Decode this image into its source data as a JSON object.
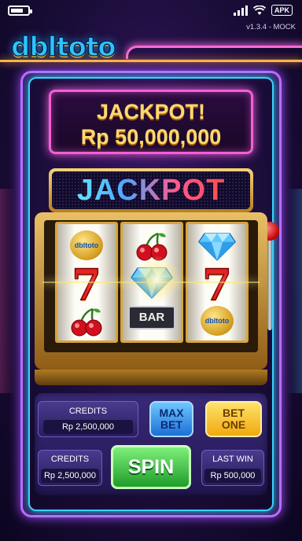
{
  "status_bar": {
    "battery_level": 0.75,
    "apk_badge": "APK",
    "icons": [
      "battery-icon",
      "signal-icon",
      "wifi-icon"
    ]
  },
  "app": {
    "version": "v1.3.4 - MOCK",
    "logo_text": "dbltoto"
  },
  "jackpot_banner": {
    "title": "JACKPOT!",
    "amount": "Rp 50,000,000"
  },
  "marquee": {
    "text": "JACKPOT"
  },
  "reels": [
    {
      "top": "dbltoto",
      "middle": "7",
      "bottom": "cherry"
    },
    {
      "top": "cherry",
      "middle": "diamond",
      "bottom": "BAR"
    },
    {
      "top": "diamond",
      "middle": "7",
      "bottom": "dbltoto"
    }
  ],
  "symbols": {
    "seven": "7",
    "bar": "BAR",
    "coin_text": "dbltoto"
  },
  "controls": {
    "credits_top_label": "CREDITS",
    "credits_top_value": "Rp 2,500,000",
    "max_bet_label": "MAX BET",
    "bet_one_label": "BET ONE",
    "credits_label": "CREDITS",
    "credits_value": "Rp 2,500,000",
    "spin_label": "SPIN",
    "last_win_label": "LAST WIN",
    "last_win_value": "Rp 500,000"
  },
  "colors": {
    "neon_pink": "#f35fd6",
    "neon_cyan": "#35d3ff",
    "gold_text": "#ffd970",
    "spin_green": "#1f9c2b"
  }
}
